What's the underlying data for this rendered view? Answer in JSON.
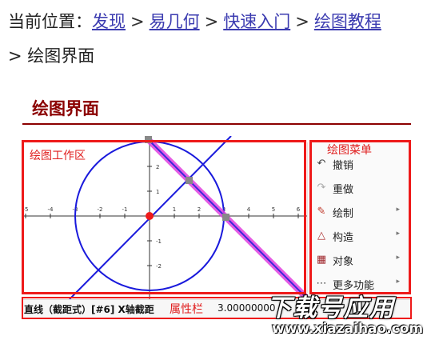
{
  "breadcrumb": {
    "prefix": "当前位置：",
    "links": [
      "发现",
      "易几何",
      "快速入门",
      "绘图教程"
    ],
    "separator": ">",
    "current": "绘图界面"
  },
  "section_title": "绘图界面",
  "screenshot": {
    "area_label": "绘图工作区",
    "menu_label": "绘图菜单",
    "menu_items": [
      {
        "label": "撤销",
        "icon": "undo-icon",
        "has_arrow": false
      },
      {
        "label": "重做",
        "icon": "redo-icon",
        "has_arrow": false
      },
      {
        "label": "绘制",
        "icon": "draw-icon",
        "has_arrow": true
      },
      {
        "label": "构造",
        "icon": "construct-icon",
        "has_arrow": true
      },
      {
        "label": "对象",
        "icon": "objects-icon",
        "has_arrow": true
      },
      {
        "label": "更多功能",
        "icon": "more-icon",
        "has_arrow": true
      }
    ],
    "x_ticks": [
      "-5",
      "-4",
      "-3",
      "-2",
      "-1",
      "1",
      "2",
      "3",
      "4",
      "5",
      "6"
    ],
    "y_ticks": [
      "2",
      "1",
      "-1",
      "-2"
    ],
    "status_text": "直线（截距式）[#6] X轴截距",
    "status_label": "属性栏",
    "status_value": "3.00000000",
    "colors": {
      "accent_red": "#ee1a1a",
      "title_red": "#8b0000",
      "link": "#3b3bb0",
      "circle": "#1a1adc",
      "highlight": "#e040e0"
    }
  },
  "watermark": {
    "main": "下载号应用",
    "url": "www.xiazaihao.com"
  }
}
